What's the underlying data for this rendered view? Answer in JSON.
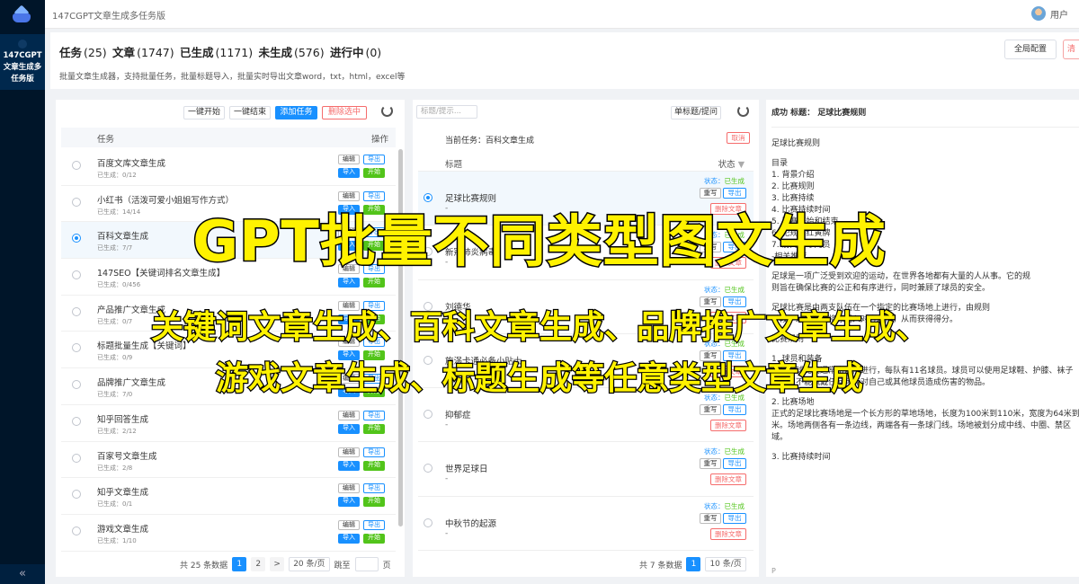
{
  "app": {
    "title": "147CGPT文章生成多任务版",
    "sidebar_label": "147CGPT文章生成多任务版",
    "collapse_glyph": "«",
    "user": "用户"
  },
  "header": {
    "stats": {
      "tasks_label": "任务",
      "tasks": "(25)",
      "articles_label": "文章",
      "articles": "(1747)",
      "done_label": "已生成",
      "done": "(1171)",
      "pending_label": "未生成",
      "pending": "(576)",
      "running_label": "进行中",
      "running": "(0)"
    },
    "description": "批量文章生成器，支持批量任务，批量标题导入，批量实时导出文章word，txt，html，excel等",
    "config_button": "全局配置",
    "edge_button": "清"
  },
  "task_panel": {
    "toolbar": {
      "start_all": "一键开始",
      "stop_all": "一键结束",
      "add_task": "添加任务",
      "delete_selected": "删除选中"
    },
    "columns": {
      "task": "任务",
      "action": "操作"
    },
    "actions": {
      "edit": "编辑",
      "export": "导出",
      "import": "导入",
      "start": "开始"
    },
    "rows": [
      {
        "name": "百度文库文章生成",
        "sub": "已生成：0/12"
      },
      {
        "name": "小红书（活泼可爱小姐姐写作方式）",
        "sub": "已生成：14/14"
      },
      {
        "name": "百科文章生成",
        "sub": "已生成：7/7"
      },
      {
        "name": "147SEO【关键词排名文章生成】",
        "sub": "已生成：0/456"
      },
      {
        "name": "产品推广文章生成",
        "sub": "已生成：0/7"
      },
      {
        "name": "标题批量生成【关键词】",
        "sub": "已生成：0/9"
      },
      {
        "name": "品牌推广文章生成",
        "sub": "已生成：7/0"
      },
      {
        "name": "知乎回答生成",
        "sub": "已生成：2/12"
      },
      {
        "name": "百家号文章生成",
        "sub": "已生成：2/8"
      },
      {
        "name": "知乎文章生成",
        "sub": "已生成：0/1"
      },
      {
        "name": "游戏文章生成",
        "sub": "已生成：1/10"
      }
    ],
    "pager": {
      "total": "共 25 条数据",
      "page1": "1",
      "page2": "2",
      "next": ">",
      "size": "20 条/页",
      "jump_label": "跳至",
      "page_unit": "页"
    }
  },
  "article_panel": {
    "search_placeholder": "标题/提示...",
    "single_button": "单标题/提问",
    "current_task": "当前任务：百科文章生成",
    "cancel": "取消",
    "columns": {
      "title": "标题",
      "status": "状态"
    },
    "status_prefix": "状态：",
    "status_value": "已生成",
    "actions": {
      "rewrite": "重写",
      "export": "导出",
      "delete": "删除文章"
    },
    "rows": [
      {
        "title": "足球比赛规则",
        "dash": "-"
      },
      {
        "title": "新冠肺炎病毒",
        "dash": "-"
      },
      {
        "title": "刘德华",
        "dash": "-"
      },
      {
        "title": "旋涡卡通必备小贴士",
        "dash": "-"
      },
      {
        "title": "抑郁症",
        "dash": "-"
      },
      {
        "title": "世界足球日",
        "dash": "-"
      },
      {
        "title": "中秋节的起源",
        "dash": "-"
      }
    ],
    "pager": {
      "total": "共 7 条数据",
      "page1": "1",
      "size": "10 条/页"
    }
  },
  "content_panel": {
    "header": "成功 标题：  足球比赛规则",
    "lines": [
      "足球比赛规则",
      "",
      "目录",
      "1. 背景介绍",
      "2. 比赛规则",
      "3. 比赛持续",
      "4. 比赛持续时间",
      "5. 比赛开始和结束",
      "6. 犯规和红黄牌",
      "7. 射门和守门员",
      "-相关推荐",
      "",
      "足球是一项广泛受到欢迎的运动，在世界各地都有大量的人从事。它的规",
      "则旨在确保比赛的公正和有序进行，同时兼顾了球员的安全。",
      "",
      "足球比赛是由两支队伍在一个指定的比赛场地上进行，由规则",
      "手段，球员需要将球踢入对方球门，从而获得得分。",
      "",
      "比赛规则",
      "",
      "1. 球员和装备",
      "一场足球比赛通常由两队进行，每队有11名球员。球员可以使用足球鞋、护膝、袜子",
      "备，但不能佩戴任何可能对自己或其他球员造成伤害的物品。",
      "",
      "2. 比赛场地",
      "正式的足球比赛场地是一个长方形的草地场地，长度为100米到110米，宽度为64米到",
      "米。场地两侧各有一条边线，两端各有一条球门线。场地被划分成中线、中圈、禁区",
      "域。",
      "",
      "3. 比赛持续时间"
    ],
    "footer": "P"
  },
  "overlay": {
    "title": "GPT批量不同类型图文生成",
    "line1": "关键词文章生成、百科文章生成、品牌推广文章生成、",
    "line2": "游戏文章生成、标题生成等任意类型文章生成"
  },
  "colors": {
    "accent": "#1890ff",
    "success": "#52c41a",
    "danger": "#f56c6c",
    "sidebar": "#001529",
    "overlay_text": "#fff200"
  }
}
